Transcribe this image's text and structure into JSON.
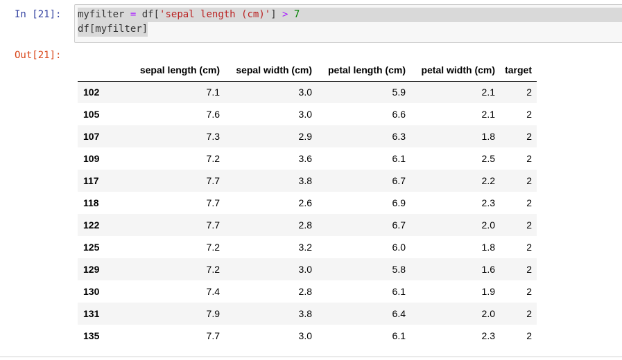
{
  "input_prompt": "In [21]:",
  "output_prompt": "Out[21]:",
  "code": {
    "line1": {
      "var": "myfilter",
      "eq": " = ",
      "mid": "df[",
      "str": "'sepal length (cm)'",
      "end": "] ",
      "op": ">",
      "space": " ",
      "num": "7"
    },
    "line2": "df[myfilter]"
  },
  "table": {
    "columns": [
      "sepal length (cm)",
      "sepal width (cm)",
      "petal length (cm)",
      "petal width (cm)",
      "target"
    ],
    "rows": [
      {
        "index": "102",
        "values": [
          "7.1",
          "3.0",
          "5.9",
          "2.1",
          "2"
        ]
      },
      {
        "index": "105",
        "values": [
          "7.6",
          "3.0",
          "6.6",
          "2.1",
          "2"
        ]
      },
      {
        "index": "107",
        "values": [
          "7.3",
          "2.9",
          "6.3",
          "1.8",
          "2"
        ]
      },
      {
        "index": "109",
        "values": [
          "7.2",
          "3.6",
          "6.1",
          "2.5",
          "2"
        ]
      },
      {
        "index": "117",
        "values": [
          "7.7",
          "3.8",
          "6.7",
          "2.2",
          "2"
        ]
      },
      {
        "index": "118",
        "values": [
          "7.7",
          "2.6",
          "6.9",
          "2.3",
          "2"
        ]
      },
      {
        "index": "122",
        "values": [
          "7.7",
          "2.8",
          "6.7",
          "2.0",
          "2"
        ]
      },
      {
        "index": "125",
        "values": [
          "7.2",
          "3.2",
          "6.0",
          "1.8",
          "2"
        ]
      },
      {
        "index": "129",
        "values": [
          "7.2",
          "3.0",
          "5.8",
          "1.6",
          "2"
        ]
      },
      {
        "index": "130",
        "values": [
          "7.4",
          "2.8",
          "6.1",
          "1.9",
          "2"
        ]
      },
      {
        "index": "131",
        "values": [
          "7.9",
          "3.8",
          "6.4",
          "2.0",
          "2"
        ]
      },
      {
        "index": "135",
        "values": [
          "7.7",
          "3.0",
          "6.1",
          "2.3",
          "2"
        ]
      }
    ]
  },
  "colors": {
    "input_prompt": "#303f9f",
    "output_prompt": "#d84315",
    "code_background": "#f7f7f7",
    "selection": "#d9d9d9",
    "string": "#ba2121",
    "operator": "#aa22ff",
    "number": "#008000",
    "striped_row": "#f5f5f5"
  }
}
